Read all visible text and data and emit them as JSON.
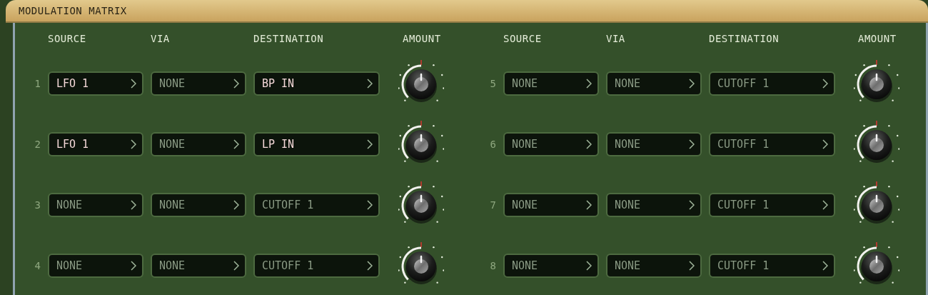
{
  "title": "MODULATION MATRIX",
  "groups": [
    {
      "headers": [
        "SOURCE",
        "VIA",
        "DESTINATION",
        "AMOUNT"
      ],
      "slots": [
        {
          "number": "1",
          "source": {
            "value": "LFO 1",
            "active": true
          },
          "via": {
            "value": "NONE",
            "active": false
          },
          "destination": {
            "value": "BP IN",
            "active": true
          }
        },
        {
          "number": "2",
          "source": {
            "value": "LFO 1",
            "active": true
          },
          "via": {
            "value": "NONE",
            "active": false
          },
          "destination": {
            "value": "LP IN",
            "active": true
          }
        },
        {
          "number": "3",
          "source": {
            "value": "NONE",
            "active": false
          },
          "via": {
            "value": "NONE",
            "active": false
          },
          "destination": {
            "value": "CUTOFF 1",
            "active": false
          }
        },
        {
          "number": "4",
          "source": {
            "value": "NONE",
            "active": false
          },
          "via": {
            "value": "NONE",
            "active": false
          },
          "destination": {
            "value": "CUTOFF 1",
            "active": false
          }
        }
      ]
    },
    {
      "headers": [
        "SOURCE",
        "VIA",
        "DESTINATION",
        "AMOUNT"
      ],
      "slots": [
        {
          "number": "5",
          "source": {
            "value": "NONE",
            "active": false
          },
          "via": {
            "value": "NONE",
            "active": false
          },
          "destination": {
            "value": "CUTOFF 1",
            "active": false
          }
        },
        {
          "number": "6",
          "source": {
            "value": "NONE",
            "active": false
          },
          "via": {
            "value": "NONE",
            "active": false
          },
          "destination": {
            "value": "CUTOFF 1",
            "active": false
          }
        },
        {
          "number": "7",
          "source": {
            "value": "NONE",
            "active": false
          },
          "via": {
            "value": "NONE",
            "active": false
          },
          "destination": {
            "value": "CUTOFF 1",
            "active": false
          }
        },
        {
          "number": "8",
          "source": {
            "value": "NONE",
            "active": false
          },
          "via": {
            "value": "NONE",
            "active": false
          },
          "destination": {
            "value": "CUTOFF 1",
            "active": false
          }
        }
      ]
    }
  ]
}
